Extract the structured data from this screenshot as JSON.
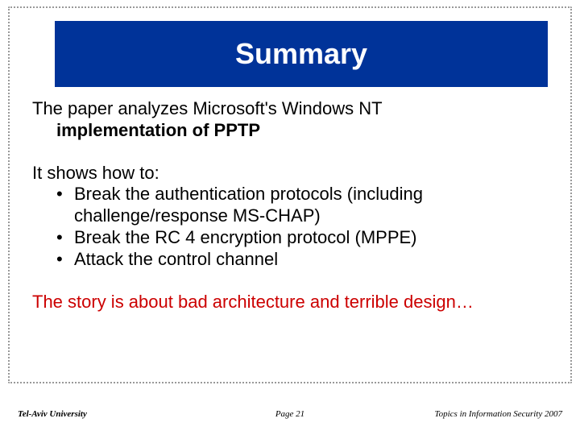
{
  "title": "Summary",
  "intro": {
    "line1": "The paper analyzes Microsoft's Windows NT",
    "line2_bold": "implementation of PPTP"
  },
  "shows_heading": "It shows how to:",
  "bullets": [
    "Break the authentication protocols (including challenge/response MS-CHAP)",
    "Break the RC 4 encryption protocol (MPPE)",
    "Attack the control channel"
  ],
  "story": "The story is about bad architecture and terrible design…",
  "footer": {
    "left": "Tel-Aviv University",
    "center": "Page 21",
    "right": "Topics in Information Security 2007"
  }
}
